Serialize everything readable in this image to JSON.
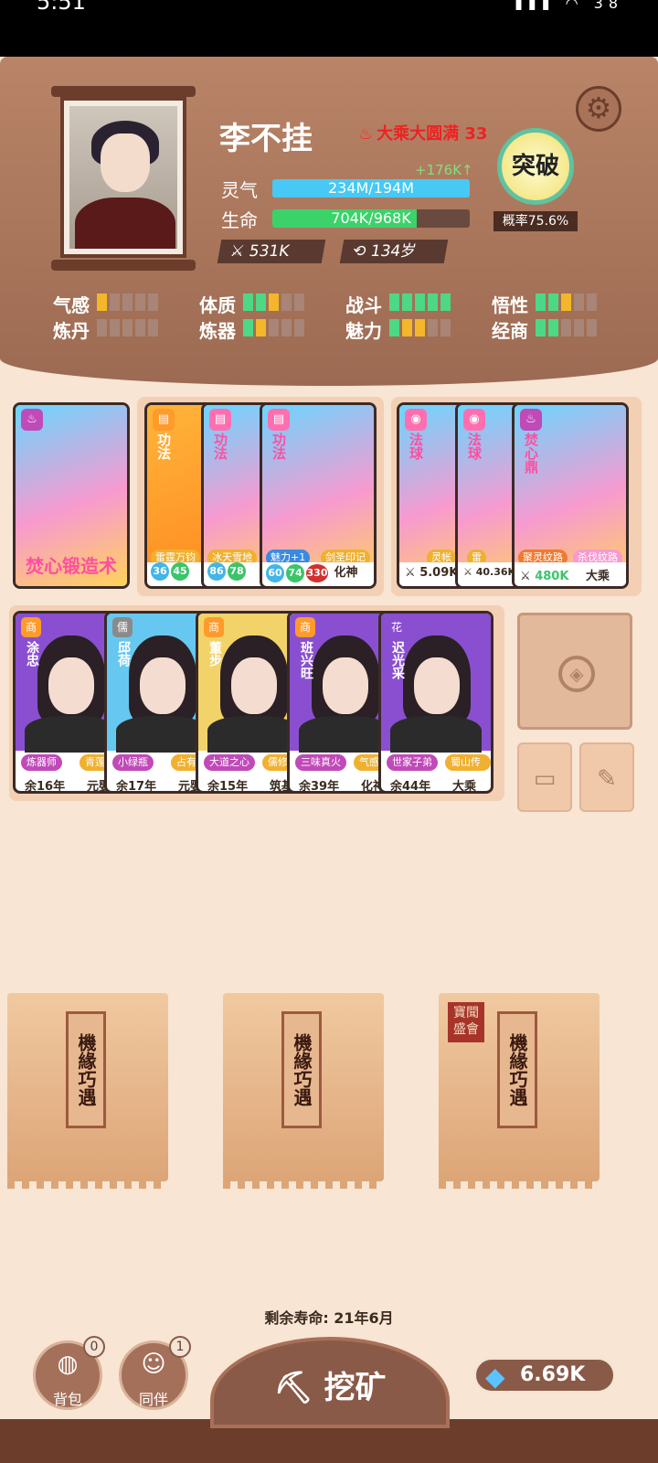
{
  "status_bar": {
    "time": "5:51",
    "battery": "38"
  },
  "player": {
    "name": "李不挂",
    "realm": "大乘大圆满 33",
    "qi_label": "灵气",
    "qi_value": "234M/194M",
    "qi_gain": "+176K↑",
    "hp_label": "生命",
    "hp_value": "704K/968K",
    "power": "531K",
    "age": "134岁",
    "break_label": "突破",
    "break_prob": "概率75.6%"
  },
  "attributes": [
    {
      "label": "气感",
      "pips": [
        "y",
        "n",
        "n",
        "n",
        "n"
      ]
    },
    {
      "label": "体质",
      "pips": [
        "g",
        "g",
        "y",
        "n",
        "n"
      ]
    },
    {
      "label": "战斗",
      "pips": [
        "g",
        "g",
        "g",
        "g",
        "g"
      ]
    },
    {
      "label": "悟性",
      "pips": [
        "g",
        "g",
        "y",
        "n",
        "n"
      ]
    },
    {
      "label": "炼丹",
      "pips": [
        "n",
        "n",
        "n",
        "n",
        "n"
      ]
    },
    {
      "label": "炼器",
      "pips": [
        "g",
        "y",
        "n",
        "n",
        "n"
      ]
    },
    {
      "label": "魅力",
      "pips": [
        "g",
        "y",
        "y",
        "n",
        "n"
      ]
    },
    {
      "label": "经商",
      "pips": [
        "g",
        "g",
        "n",
        "n",
        "n"
      ]
    }
  ],
  "skill_card": {
    "title": "焚心锻造术"
  },
  "gongfa": {
    "card1_type": "功法",
    "card1_tag": "雷霆万钧",
    "card2_type": "功法",
    "card2_tag": "冰天雪地",
    "card3_type": "功法",
    "card3_tag1": "魅力+1",
    "card3_tag2": "剑圣印记",
    "n1": "36",
    "n2": "45",
    "n3": "86",
    "n4": "78",
    "n5": "60",
    "n6": "74",
    "n7": "330",
    "rank": "化神"
  },
  "treasures": {
    "t1_type": "法球",
    "t1_tag": "灵帐",
    "t1_power": "5.09K",
    "t2_type": "法球",
    "t2_tag": "雷",
    "t2_power": "40.36K",
    "t3_type": "焚心鼎",
    "t3_tag1": "聚灵纹路",
    "t3_tag2": "杀伐纹路",
    "t3_power": "480K",
    "t3_rank": "大乘"
  },
  "companions": [
    {
      "badge": "商",
      "name": "涂忠",
      "tag1": "炼器师",
      "tag2": "青莲",
      "life": "余16年",
      "rank": "元婴"
    },
    {
      "badge": "儒",
      "name": "邱荷",
      "tag1": "小绿瓶",
      "tag2": "占有",
      "life": "余17年",
      "rank": "元婴"
    },
    {
      "badge": "商",
      "name": "董步",
      "tag1": "大道之心",
      "tag2": "儒修",
      "life": "余15年",
      "rank": "筑基"
    },
    {
      "badge": "商",
      "name": "班兴旺",
      "tag1": "三味真火",
      "tag2": "气感",
      "life": "余39年",
      "rank": "化神"
    },
    {
      "badge": "花",
      "name": "迟光采",
      "tag1": "世家子弟",
      "tag2": "蜀山传人",
      "life": "余44年",
      "rank": "大乘"
    }
  ],
  "bags": [
    {
      "label": "機緣巧遇"
    },
    {
      "label": "機緣巧遇"
    },
    {
      "label": "機緣巧遇",
      "stamp": "寶聞盛會"
    }
  ],
  "lifespan": "剩余寿命: 21年6月",
  "bottom": {
    "bag_label": "背包",
    "bag_count": "0",
    "partner_label": "同伴",
    "partner_count": "1",
    "mine_label": "挖矿",
    "gems": "6.69K"
  },
  "colors": {
    "header": "#9c6a52",
    "qi_bar": "#48c8f5",
    "hp_bar": "#3cd26a",
    "bg": "#f8e5d3"
  }
}
